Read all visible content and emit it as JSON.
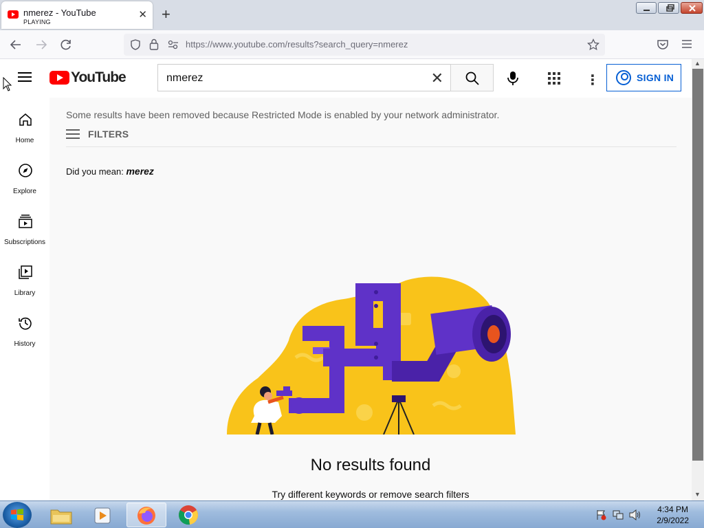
{
  "browser": {
    "tab": {
      "title": "nmerez - YouTube",
      "status": "PLAYING"
    },
    "url_host": "https://www.youtube.com",
    "url_path": "/results?search_query=nmerez"
  },
  "youtube": {
    "logo_text": "YouTube",
    "search_value": "nmerez",
    "sign_in_label": "SIGN IN",
    "sidebar": [
      {
        "label": "Home",
        "icon": "home-icon"
      },
      {
        "label": "Explore",
        "icon": "compass-icon"
      },
      {
        "label": "Subscriptions",
        "icon": "subscriptions-icon"
      },
      {
        "label": "Library",
        "icon": "library-icon"
      },
      {
        "label": "History",
        "icon": "history-icon"
      }
    ],
    "notice": "Some results have been removed because Restricted Mode is enabled by your network administrator.",
    "filters_label": "FILTERS",
    "did_you_mean_prefix": "Did you mean:",
    "did_you_mean_term": "merez",
    "no_results_title": "No results found",
    "no_results_hint": "Try different keywords or remove search filters"
  },
  "taskbar": {
    "time": "4:34 PM",
    "date": "2/9/2022"
  },
  "colors": {
    "brand_red": "#ff0000",
    "link_blue": "#065fd4",
    "illustration_yellow": "#f9c31a",
    "illustration_purple": "#5f32c8"
  }
}
